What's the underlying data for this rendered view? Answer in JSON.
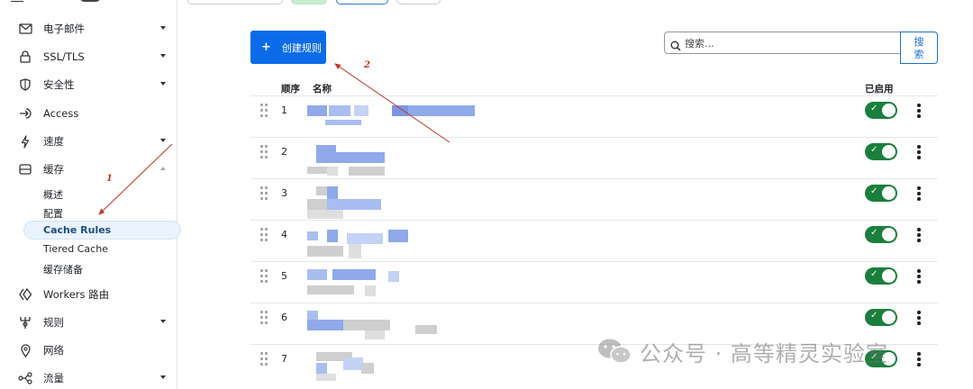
{
  "sidebar": {
    "items": [
      {
        "label": "电子邮件",
        "icon": "envelope-icon",
        "has_caret": true
      },
      {
        "label": "SSL/TLS",
        "icon": "lock-icon",
        "has_caret": true
      },
      {
        "label": "安全性",
        "icon": "shield-icon",
        "has_caret": true
      },
      {
        "label": "Access",
        "icon": "access-icon",
        "has_caret": false
      },
      {
        "label": "速度",
        "icon": "lightning-icon",
        "has_caret": true
      },
      {
        "label": "缓存",
        "icon": "cache-drive-icon",
        "has_caret": true,
        "expanded": true
      },
      {
        "label": "Workers 路由",
        "icon": "workers-icon",
        "has_caret": false
      },
      {
        "label": "规则",
        "icon": "rules-icon",
        "has_caret": true
      },
      {
        "label": "网络",
        "icon": "location-pin-icon",
        "has_caret": false
      },
      {
        "label": "流量",
        "icon": "traffic-icon",
        "has_caret": true
      }
    ],
    "cache_subitems": [
      "概述",
      "配置",
      "Cache Rules",
      "Tiered Cache",
      "缓存储备"
    ],
    "active_subitem": "Cache Rules"
  },
  "main": {
    "create_button": {
      "icon": "plus-icon",
      "label": "创建规则"
    },
    "search": {
      "placeholder": "搜索...",
      "button_label": "搜索",
      "icon": "search-icon"
    },
    "table": {
      "headers": {
        "order": "顺序",
        "name": "名称",
        "enabled": "已启用"
      },
      "rows": [
        {
          "order": "1",
          "enabled": true
        },
        {
          "order": "2",
          "enabled": true
        },
        {
          "order": "3",
          "enabled": true
        },
        {
          "order": "4",
          "enabled": true
        },
        {
          "order": "5",
          "enabled": true
        },
        {
          "order": "6",
          "enabled": true
        },
        {
          "order": "7",
          "enabled": true
        }
      ]
    }
  },
  "annotations": {
    "marker_1": "1",
    "marker_2": "2",
    "color": "#c0392b"
  },
  "watermark": {
    "text": "公众号 · 高等精灵实验室",
    "icon": "wechat-icon"
  },
  "colors": {
    "primary": "#0b6be8",
    "toggle_on": "#1a7f3c",
    "active_bg": "#eaf3fd",
    "active_text": "#1a4f86"
  }
}
